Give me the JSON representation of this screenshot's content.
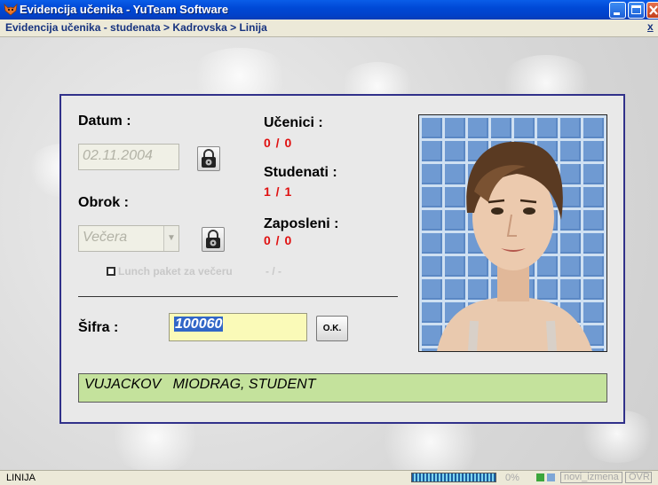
{
  "window": {
    "title": "Evidencija učenika - YuTeam Software",
    "breadcrumb": "Evidencija učenika - studenata > Kadrovska > Linija",
    "breadcrumb_close": "x"
  },
  "form": {
    "datum_label": "Datum :",
    "datum_value": "02.11.2004",
    "obrok_label": "Obrok :",
    "obrok_value": "Večera",
    "lunch_label": "Lunch paket za večeru",
    "lunch_value": "- / -",
    "sifra_label": "Šifra :",
    "sifra_value": "100060",
    "ok_label": "O.K.",
    "result": "VUJACKOV   MIODRAG, STUDENT"
  },
  "counts": {
    "ucenici_label": "Učenici :",
    "ucenici_value": "0 / 0",
    "studenati_label": "Studenati :",
    "studenati_value": "1 / 1",
    "zaposleni_label": "Zaposleni :",
    "zaposleni_value": "0 / 0"
  },
  "statusbar": {
    "text": "LINIJA",
    "progress_percent": "0%",
    "panel1": "novi_izmena",
    "panel2": "OVR"
  },
  "colors": {
    "title_bar": "#0049d6",
    "red_values": "#e01010",
    "panel_border": "#31318a",
    "result_bg": "#c4e29c",
    "input_bg": "#fafab8"
  }
}
